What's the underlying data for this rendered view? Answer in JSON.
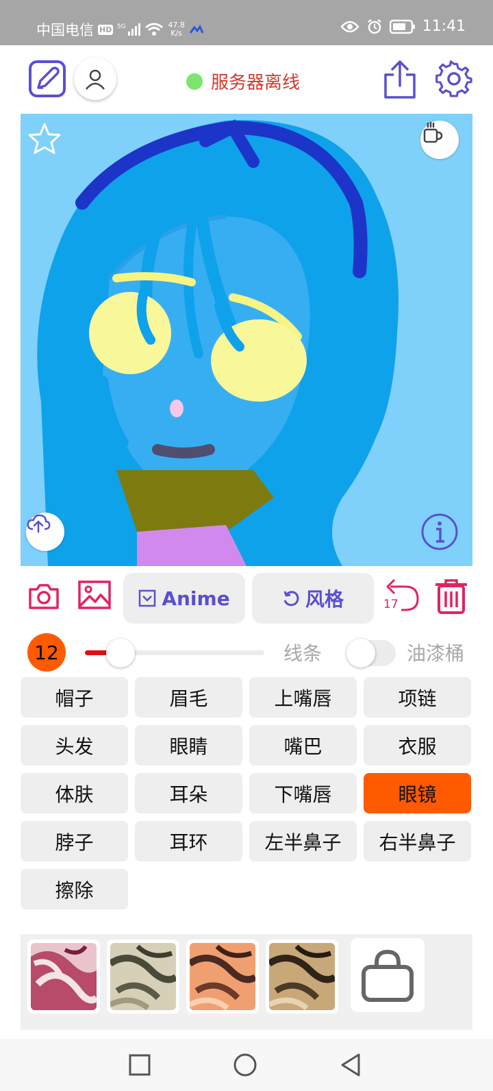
{
  "status_bar": {
    "carrier": "中国电信",
    "hd": "HD",
    "net_speed_value": "47.8",
    "net_speed_unit": "K/s",
    "time": "11:41"
  },
  "header": {
    "server_status": "服务器离线"
  },
  "controls": {
    "model_label": "Anime",
    "style_label": "风格",
    "undo_count": "17"
  },
  "brush": {
    "size": "12",
    "size_fraction": 0.2,
    "line_label": "线条",
    "bucket_label": "油漆桶",
    "bucket_enabled": false
  },
  "parts": [
    {
      "label": "帽子"
    },
    {
      "label": "眉毛"
    },
    {
      "label": "上嘴唇"
    },
    {
      "label": "项链"
    },
    {
      "label": "头发"
    },
    {
      "label": "眼睛"
    },
    {
      "label": "嘴巴"
    },
    {
      "label": "衣服"
    },
    {
      "label": "体肤"
    },
    {
      "label": "耳朵"
    },
    {
      "label": "下嘴唇"
    },
    {
      "label": "眼镜"
    },
    {
      "label": "脖子"
    },
    {
      "label": "耳环"
    },
    {
      "label": "左半鼻子"
    },
    {
      "label": "右半鼻子"
    },
    {
      "label": "擦除"
    }
  ],
  "selected_part": "眼镜",
  "colors": {
    "accent": "#ff5a00",
    "primary": "#5a4fd0",
    "danger": "#e0245e",
    "server_offline": "#d33a2c",
    "online_dot": "#7ce56f",
    "canvas_bg": "#7fd0fb"
  }
}
